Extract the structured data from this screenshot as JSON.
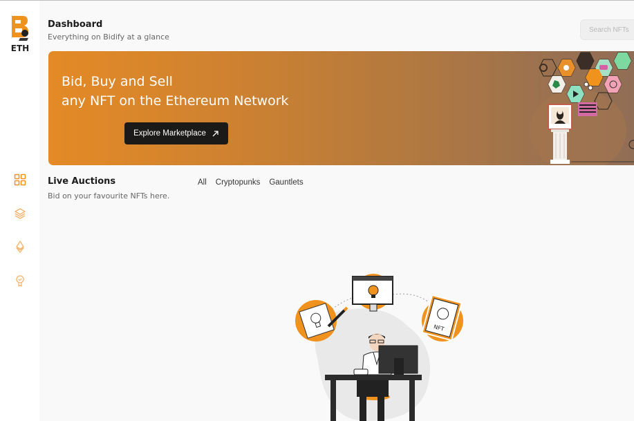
{
  "app": {
    "logo_text": "ETH"
  },
  "sidebar": {
    "items": [
      {
        "icon": "grid-icon",
        "active": true
      },
      {
        "icon": "layers-icon",
        "active": false
      },
      {
        "icon": "ethereum-icon",
        "active": false
      },
      {
        "icon": "award-icon",
        "active": false
      }
    ]
  },
  "header": {
    "title": "Dashboard",
    "subtitle": "Everything on Bidify at a glance",
    "search_placeholder": "Search NFTs"
  },
  "banner": {
    "line1": "Bid, Buy and Sell",
    "line2": "any NFT on the Ethereum Network",
    "button_label": "Explore Marketplace",
    "button_icon": "arrow-up-right-icon"
  },
  "live_auctions": {
    "title": "Live Auctions",
    "subtitle": "Bid on your favourite NFTs here.",
    "filters": [
      "All",
      "Cryptopunks",
      "Gauntlets"
    ]
  },
  "colors": {
    "accent": "#f0921e",
    "dark": "#1c1a18"
  }
}
